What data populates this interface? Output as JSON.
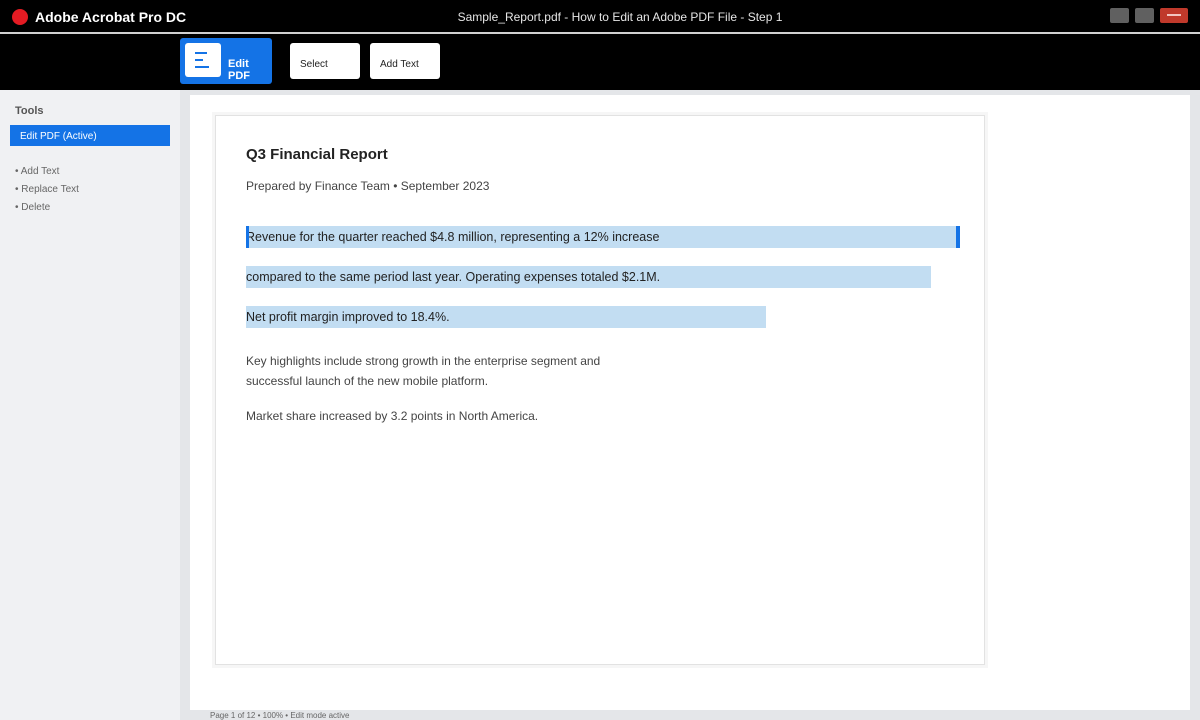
{
  "app": {
    "name": "Adobe Acrobat Pro DC",
    "window_title": "Sample_Report.pdf - How to Edit an Adobe PDF File - Step 1",
    "brand_color": "#e41b23",
    "accent_color": "#1473e6"
  },
  "toolbar": {
    "edit_pdf_label": "Edit PDF",
    "select_label": "Select",
    "add_text_label": "Add Text"
  },
  "sidebar": {
    "heading": "Tools",
    "active_item": "Edit PDF (Active)",
    "items": [
      "• Add Text",
      "• Replace Text",
      "• Delete"
    ]
  },
  "document": {
    "title": "Q3 Financial Report",
    "subtitle": "Prepared by Finance Team • September 2023",
    "selected_lines": [
      "Revenue for the quarter reached $4.8 million, representing a 12% increase",
      "compared to the same period last year. Operating expenses totaled $2.1M.",
      "Net profit margin improved to 18.4%."
    ],
    "paragraphs": [
      "Key highlights include strong growth in the enterprise segment and",
      "successful launch of the new mobile platform.",
      "Market share increased by 3.2 points in North America."
    ]
  },
  "status": {
    "text": "Page 1 of 12 • 100% • Edit mode active"
  }
}
